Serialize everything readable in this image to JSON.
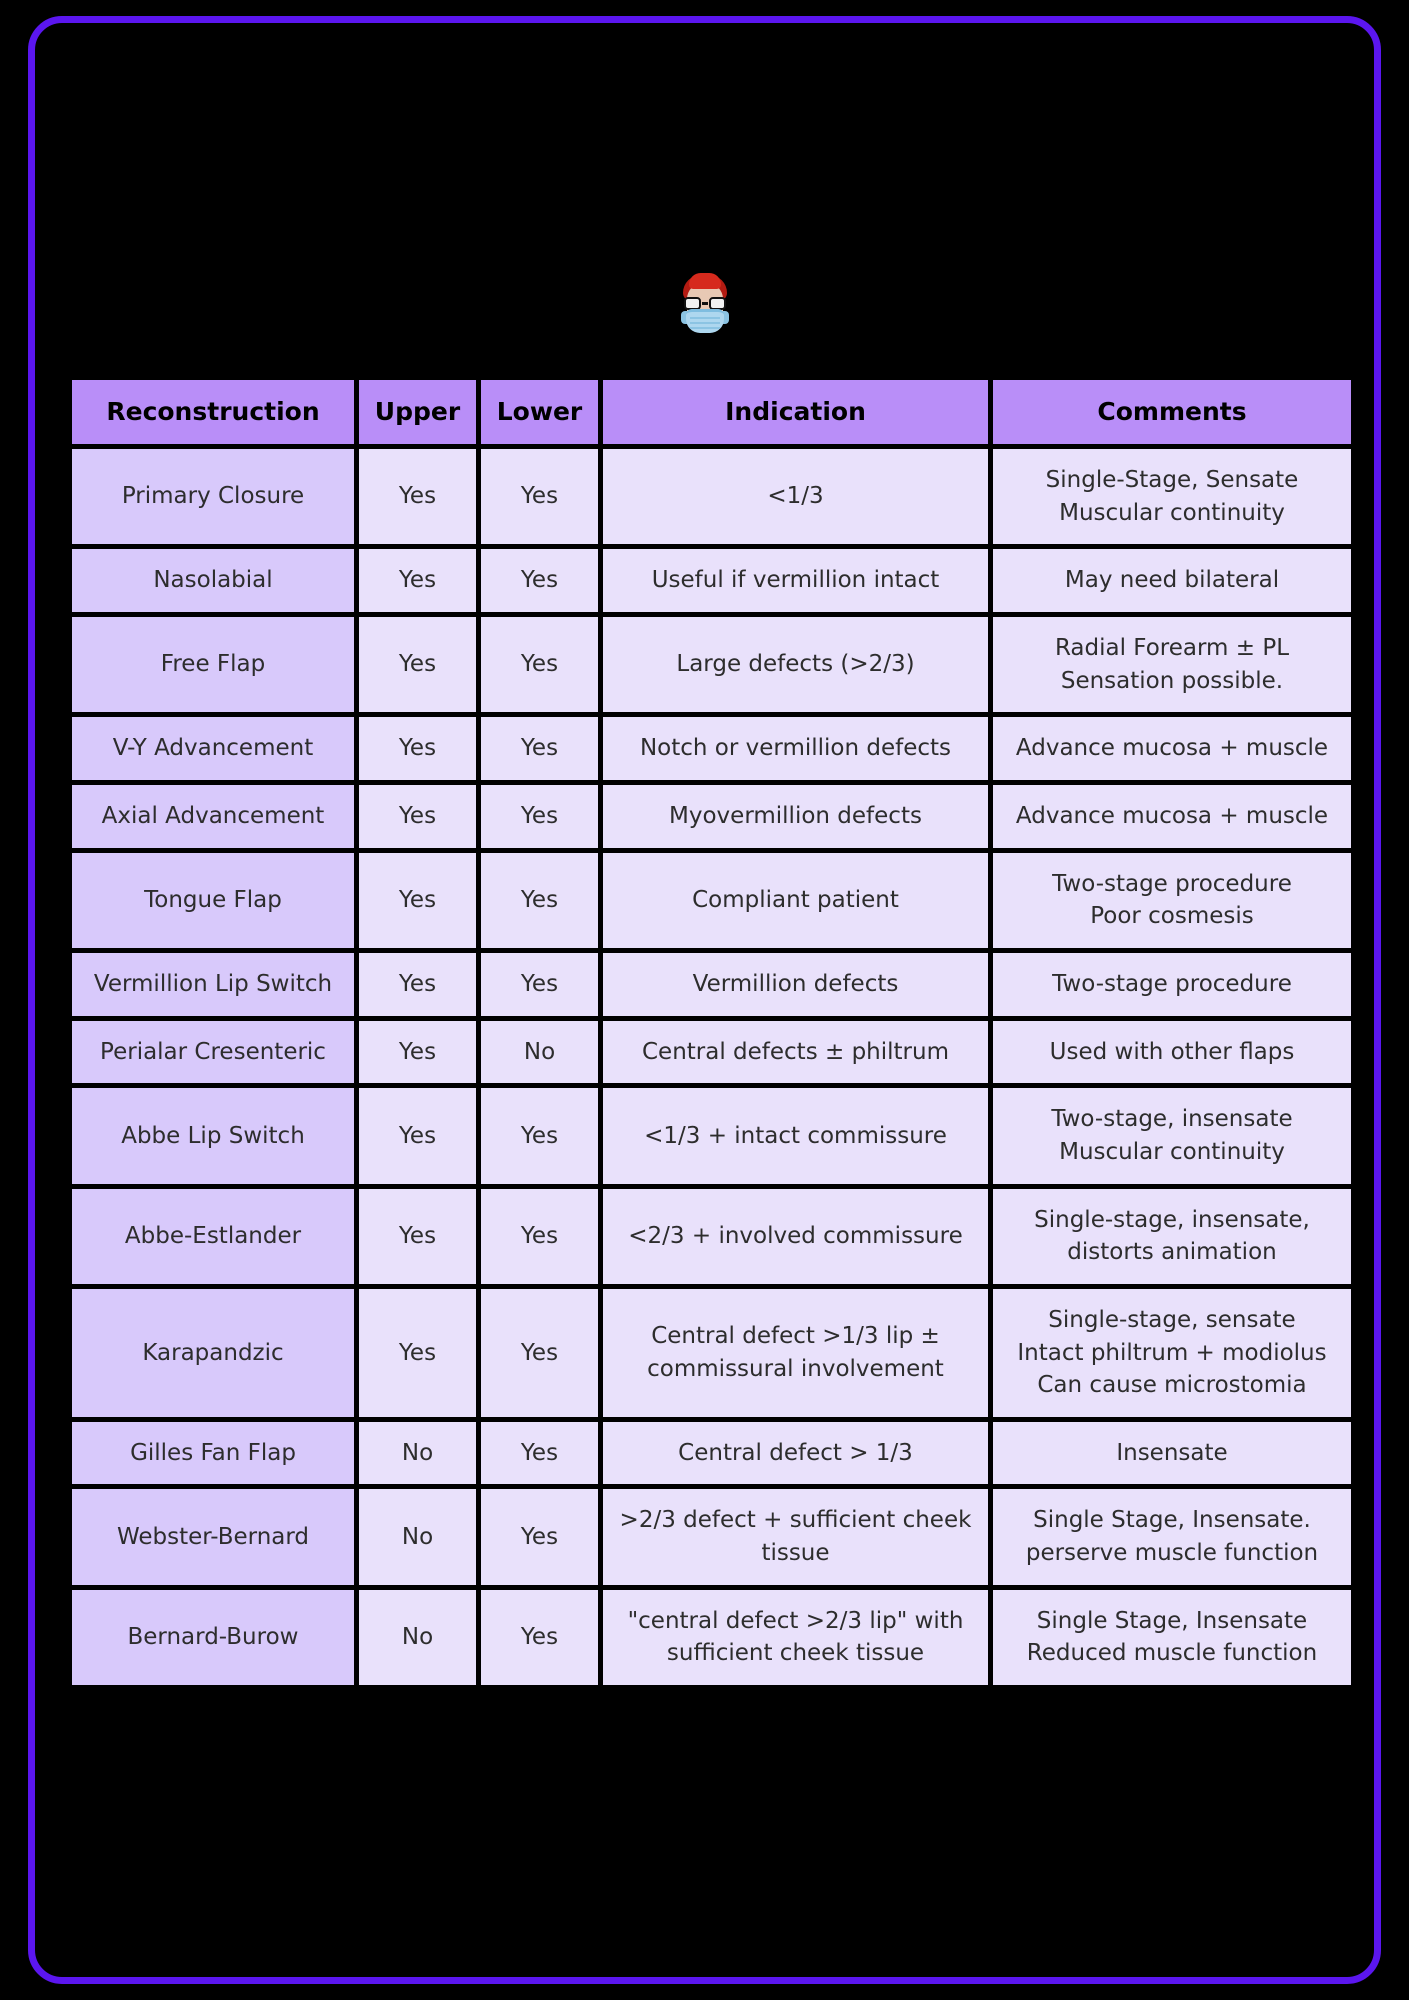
{
  "avatar": {
    "icon": "doctor-with-mask-avatar",
    "description": "Person with red hair, black glasses and blue surgical mask"
  },
  "colors": {
    "frame_border": "#5b16ef",
    "page_background": "#000000",
    "header_cell": "#b98ef8",
    "first_column_cell": "#d8c9fb",
    "body_cell": "#e9e1fb",
    "text": "#2d2d2d"
  },
  "table": {
    "headers": [
      "Reconstruction",
      "Upper",
      "Lower",
      "Indication",
      "Comments"
    ],
    "rows": [
      {
        "reconstruction": "Primary Closure",
        "upper": "Yes",
        "lower": "Yes",
        "indication": "<1/3",
        "comments": [
          "Single-Stage, Sensate",
          "Muscular continuity"
        ]
      },
      {
        "reconstruction": "Nasolabial",
        "upper": "Yes",
        "lower": "Yes",
        "indication": "Useful if vermillion intact",
        "comments": [
          "May need bilateral"
        ]
      },
      {
        "reconstruction": "Free Flap",
        "upper": "Yes",
        "lower": "Yes",
        "indication": "Large defects (>2/3)",
        "comments": [
          "Radial Forearm ± PL",
          "Sensation possible."
        ]
      },
      {
        "reconstruction": "V-Y Advancement",
        "upper": "Yes",
        "lower": "Yes",
        "indication": "Notch or vermillion defects",
        "comments": [
          "Advance mucosa + muscle"
        ]
      },
      {
        "reconstruction": "Axial Advancement",
        "upper": "Yes",
        "lower": "Yes",
        "indication": "Myovermillion defects",
        "comments": [
          "Advance mucosa + muscle"
        ]
      },
      {
        "reconstruction": "Tongue Flap",
        "upper": "Yes",
        "lower": "Yes",
        "indication": "Compliant patient",
        "comments": [
          "Two-stage procedure",
          "Poor cosmesis"
        ]
      },
      {
        "reconstruction": "Vermillion Lip Switch",
        "upper": "Yes",
        "lower": "Yes",
        "indication": "Vermillion defects",
        "comments": [
          "Two-stage procedure"
        ]
      },
      {
        "reconstruction": "Perialar Cresenteric",
        "upper": "Yes",
        "lower": "No",
        "indication": "Central defects ± philtrum",
        "comments": [
          "Used with other flaps"
        ]
      },
      {
        "reconstruction": "Abbe Lip Switch",
        "upper": "Yes",
        "lower": "Yes",
        "indication": "<1/3 + intact commissure",
        "comments": [
          "Two-stage, insensate",
          "Muscular continuity"
        ]
      },
      {
        "reconstruction": "Abbe-Estlander",
        "upper": "Yes",
        "lower": "Yes",
        "indication": "<2/3 + involved commissure",
        "comments": [
          "Single-stage, insensate,",
          "distorts animation"
        ]
      },
      {
        "reconstruction": "Karapandzic",
        "upper": "Yes",
        "lower": "Yes",
        "indication": "Central defect >1/3 lip ± commissural involvement",
        "comments": [
          "Single-stage, sensate",
          "Intact philtrum + modiolus",
          "Can cause microstomia"
        ]
      },
      {
        "reconstruction": "Gilles Fan Flap",
        "upper": "No",
        "lower": "Yes",
        "indication": "Central defect > 1/3",
        "comments": [
          "Insensate"
        ]
      },
      {
        "reconstruction": "Webster-Bernard",
        "upper": "No",
        "lower": "Yes",
        "indication": ">2/3 defect + sufficient cheek tissue",
        "comments": [
          "Single Stage, Insensate.",
          "perserve muscle function"
        ]
      },
      {
        "reconstruction": "Bernard-Burow",
        "upper": "No",
        "lower": "Yes",
        "indication": "\"central defect >2/3 lip\" with sufficient cheek tissue",
        "comments": [
          "Single Stage, Insensate",
          "Reduced muscle function"
        ]
      }
    ]
  }
}
